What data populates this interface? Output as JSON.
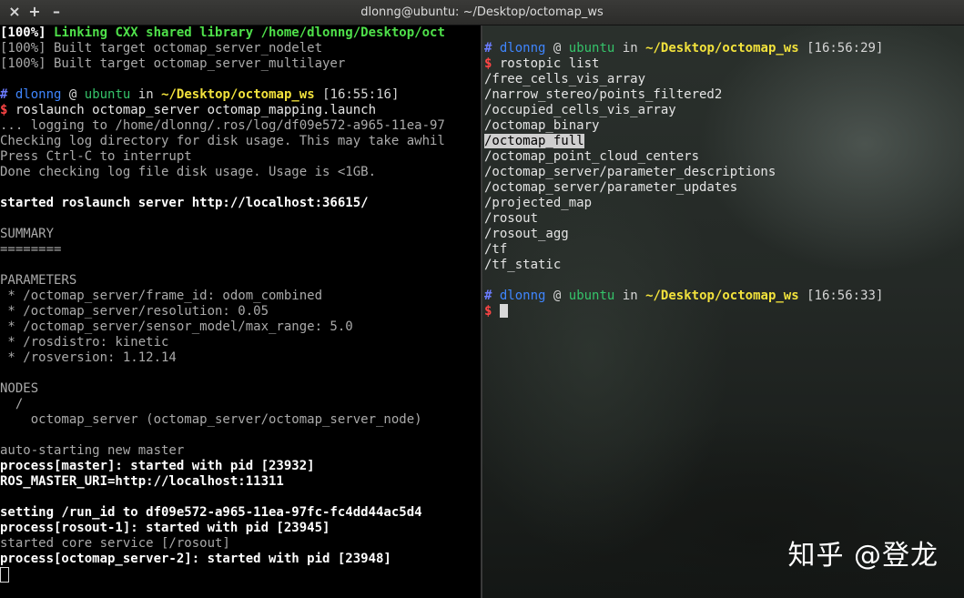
{
  "window": {
    "title": "dlonng@ubuntu: ~/Desktop/octomap_ws",
    "buttons": {
      "close": "×",
      "new_tab": "+",
      "minimize": "–"
    }
  },
  "left_terminal": {
    "build_lines": [
      {
        "prefix": "[100%] ",
        "text": "Linking CXX shared library /home/dlonng/Desktop/oct"
      },
      {
        "text": "[100%] Built target octomap_server_nodelet"
      },
      {
        "text": "[100%] Built target octomap_server_multilayer"
      }
    ],
    "prompt": {
      "hash": "#",
      "user": "dlonng",
      "at": "@",
      "host": "ubuntu",
      "in": "in",
      "path": "~/Desktop/octomap_ws",
      "time": "[16:55:16]",
      "dollar": "$"
    },
    "command": "roslaunch octomap_server octomap_mapping.launch",
    "log_lines": [
      "... logging to /home/dlonng/.ros/log/df09e572-a965-11ea-97",
      "Checking log directory for disk usage. This may take awhil",
      "Press Ctrl-C to interrupt",
      "Done checking log file disk usage. Usage is <1GB."
    ],
    "server_line": "started roslaunch server http://localhost:36615/",
    "summary": "SUMMARY",
    "summary_rule": "========",
    "parameters_header": "PARAMETERS",
    "parameters": [
      " * /octomap_server/frame_id: odom_combined",
      " * /octomap_server/resolution: 0.05",
      " * /octomap_server/sensor_model/max_range: 5.0",
      " * /rosdistro: kinetic",
      " * /rosversion: 1.12.14"
    ],
    "nodes_header": "NODES",
    "nodes_root": "  /",
    "nodes_item": "    octomap_server (octomap_server/octomap_server_node)",
    "auto_master": "auto-starting new master",
    "process_master": "process[master]: started with pid [23932]",
    "master_uri": "ROS_MASTER_URI=http://localhost:11311",
    "run_id": "setting /run_id to df09e572-a965-11ea-97fc-fc4dd44ac5d4",
    "process_rosout": "process[rosout-1]: started with pid [23945]",
    "core_service": "started core service [/rosout]",
    "process_server": "process[octomap_server-2]: started with pid [23948]"
  },
  "right_terminal": {
    "prompt1": {
      "hash": "#",
      "user": "dlonng",
      "at": "@",
      "host": "ubuntu",
      "in": "in",
      "path": "~/Desktop/octomap_ws",
      "time": "[16:56:29]",
      "dollar": "$"
    },
    "command": "rostopic list",
    "topics": [
      "/free_cells_vis_array",
      "/narrow_stereo/points_filtered2",
      "/occupied_cells_vis_array",
      "/octomap_binary",
      "/octomap_full",
      "/octomap_point_cloud_centers",
      "/octomap_server/parameter_descriptions",
      "/octomap_server/parameter_updates",
      "/projected_map",
      "/rosout",
      "/rosout_agg",
      "/tf",
      "/tf_static"
    ],
    "selected_topic_index": 4,
    "prompt2": {
      "hash": "#",
      "user": "dlonng",
      "at": "@",
      "host": "ubuntu",
      "in": "in",
      "path": "~/Desktop/octomap_ws",
      "time": "[16:56:33]",
      "dollar": "$"
    }
  },
  "watermark": "知乎 @登龙",
  "colors": {
    "terminal_bg": "#000000",
    "text": "#aaaaaa",
    "bold_text": "#ffffff",
    "green": "#4fe04a",
    "user": "#3f86ff",
    "host": "#35c46a",
    "path": "#f2e23c",
    "dollar": "#ff4545",
    "hash": "#6b7cff"
  }
}
